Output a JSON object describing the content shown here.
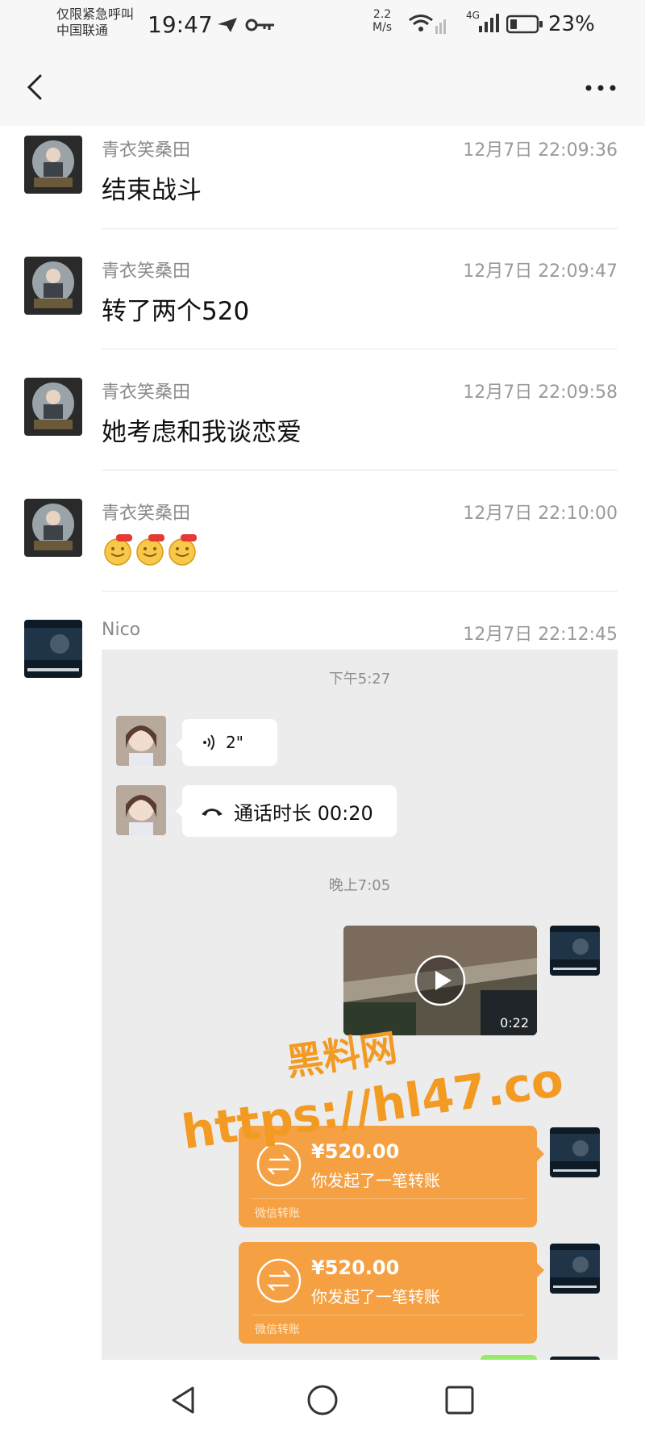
{
  "status_bar": {
    "carrier_line1": "仅限紧急呼叫",
    "carrier_line2": "中国联通",
    "time": "19:47",
    "net_speed_value": "2.2",
    "net_speed_unit": "M/s",
    "network_label": "4G",
    "battery": "23%"
  },
  "header": {
    "back_icon": "chevron-left-icon",
    "more_icon": "more-dots-icon"
  },
  "records": [
    {
      "sender": "青衣笑桑田",
      "time": "12月7日 22:09:36",
      "text": "结束战斗"
    },
    {
      "sender": "青衣笑桑田",
      "time": "12月7日 22:09:47",
      "text": "转了两个520"
    },
    {
      "sender": "青衣笑桑田",
      "time": "12月7日 22:09:58",
      "text": "她考虑和我谈恋爱"
    },
    {
      "sender": "青衣笑桑田",
      "time": "12月7日 22:10:00",
      "text": ""
    },
    {
      "sender": "Nico",
      "time": "12月7日 22:12:45",
      "text": ""
    }
  ],
  "forwarded_chat": {
    "time_1": "下午5:27",
    "voice_duration": "2\"",
    "call_text": "通话时长 00:20",
    "time_2": "晚上7:05",
    "video_duration": "0:22",
    "transfers": [
      {
        "amount": "¥520.00",
        "desc": "你发起了一笔转账",
        "footer": "微信转账"
      },
      {
        "amount": "¥520.00",
        "desc": "你发起了一笔转账",
        "footer": "微信转账"
      }
    ]
  },
  "watermark": {
    "line1": "黑料网",
    "line2": "https://hl47.co"
  },
  "colors": {
    "transfer_orange": "#f5a042",
    "panel_bg": "#ececec",
    "watermark": "#f39a23"
  }
}
